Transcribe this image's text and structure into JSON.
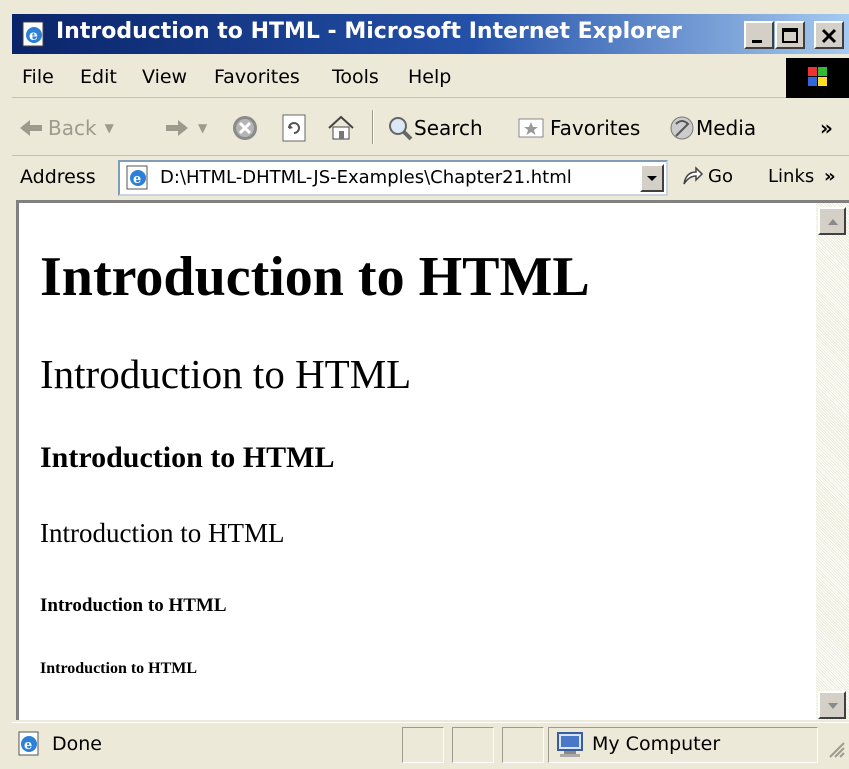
{
  "window": {
    "title": "Introduction to HTML - Microsoft Internet Explorer"
  },
  "menu": {
    "items": [
      {
        "label": "File"
      },
      {
        "label": "Edit"
      },
      {
        "label": "View"
      },
      {
        "label": "Favorites"
      },
      {
        "label": "Tools"
      },
      {
        "label": "Help"
      }
    ]
  },
  "toolbar": {
    "back_label": "Back",
    "search_label": "Search",
    "favorites_label": "Favorites",
    "media_label": "Media",
    "chevron": "»"
  },
  "address": {
    "label": "Address",
    "url": "D:\\HTML-DHTML-JS-Examples\\Chapter21.html",
    "go_label": "Go",
    "links_label": "Links",
    "links_chevron": "»"
  },
  "page": {
    "h1": "Introduction to HTML",
    "h2": "Introduction to HTML",
    "h3": "Introduction to HTML",
    "h4": "Introduction to HTML",
    "h5": "Introduction to HTML",
    "h6": "Introduction to HTML"
  },
  "status": {
    "text": "Done",
    "zone": "My Computer"
  },
  "colors": {
    "titlebar_start": "#0a246a",
    "titlebar_end": "#a6caf0",
    "chrome": "#ece9d8"
  },
  "icons": [
    "ie-page-icon",
    "minimize-icon",
    "maximize-icon",
    "close-icon",
    "windows-logo-icon",
    "back-arrow-icon",
    "forward-arrow-icon",
    "stop-icon",
    "refresh-icon",
    "home-icon",
    "search-icon",
    "favorites-icon",
    "media-icon",
    "go-arrow-icon",
    "my-computer-icon"
  ]
}
